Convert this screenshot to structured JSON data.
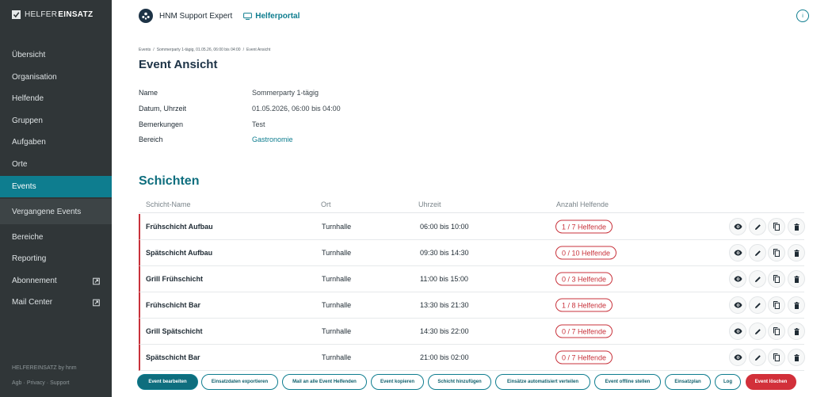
{
  "sidebar": {
    "logo_light": "HELFER",
    "logo_bold": "EINSATZ",
    "items": [
      {
        "label": "Übersicht"
      },
      {
        "label": "Organisation"
      },
      {
        "label": "Helfende"
      },
      {
        "label": "Gruppen"
      },
      {
        "label": "Aufgaben"
      },
      {
        "label": "Orte"
      },
      {
        "label": "Events"
      },
      {
        "label": "Vergangene Events"
      },
      {
        "label": "Bereiche"
      },
      {
        "label": "Reporting"
      },
      {
        "label": "Abonnement"
      },
      {
        "label": "Mail Center"
      }
    ],
    "footer_brand": "HELFEREINSATZ by hnm",
    "footer_links": [
      "Agb",
      "Privacy",
      "Support"
    ],
    "footer_sep": "·"
  },
  "header": {
    "org_name": "HNM Support Expert",
    "portal_label": "Helferportal",
    "info_label": "i"
  },
  "breadcrumb": {
    "items": [
      "Events",
      "Sommerparty 1-tägig, 01.05.26, 06:00 bis 04:00",
      "Event Ansicht"
    ],
    "sep": "/"
  },
  "page_title": "Event Ansicht",
  "details": [
    {
      "label": "Name",
      "value": "Sommerparty 1-tägig"
    },
    {
      "label": "Datum, Uhrzeit",
      "value": "01.05.2026, 06:00 bis 04:00"
    },
    {
      "label": "Bemerkungen",
      "value": "Test"
    },
    {
      "label": "Bereich",
      "value": "Gastronomie"
    }
  ],
  "schichten": {
    "title": "Schichten",
    "headers": {
      "name": "Schicht-Name",
      "ort": "Ort",
      "zeit": "Uhrzeit",
      "anzahl": "Anzahl Helfende"
    },
    "rows": [
      {
        "name": "Frühschicht Aufbau",
        "ort": "Turnhalle",
        "zeit": "06:00 bis 10:00",
        "anzahl": "1 / 7 Helfende"
      },
      {
        "name": "Spätschicht Aufbau",
        "ort": "Turnhalle",
        "zeit": "09:30 bis 14:30",
        "anzahl": "0 / 10 Helfende"
      },
      {
        "name": "Grill Frühschicht",
        "ort": "Turnhalle",
        "zeit": "11:00 bis 15:00",
        "anzahl": "0 / 3 Helfende"
      },
      {
        "name": "Frühschicht Bar",
        "ort": "Turnhalle",
        "zeit": "13:30 bis 21:30",
        "anzahl": "1 / 8 Helfende"
      },
      {
        "name": "Grill Spätschicht",
        "ort": "Turnhalle",
        "zeit": "14:30 bis 22:00",
        "anzahl": "0 / 7 Helfende"
      },
      {
        "name": "Spätschicht Bar",
        "ort": "Turnhalle",
        "zeit": "21:00 bis 02:00",
        "anzahl": "0 / 7 Helfende"
      }
    ],
    "row_actions": [
      "eye-icon",
      "pencil-icon",
      "copy-icon",
      "trash-icon"
    ]
  },
  "buttons": {
    "edit": "Event bearbeiten",
    "export": "Einsatzdaten exportieren",
    "mail": "Mail an alle Event Helfenden",
    "copy": "Event kopieren",
    "add_shift": "Schicht hinzufügen",
    "distribute": "Einsätze automatisiert verteilen",
    "offline": "Event offline stellen",
    "plan": "Einsatzplan",
    "log": "Log",
    "delete": "Event löschen"
  },
  "colors": {
    "sidebar_bg": "#303638",
    "accent": "#0e7d8f",
    "danger": "#d2303a",
    "title": "#1d3346"
  },
  "icons": {
    "logo": "checkbox-logo-icon",
    "org": "organization-icon",
    "portal": "monitor-icon",
    "info": "info-icon",
    "external": "external-link-icon"
  }
}
